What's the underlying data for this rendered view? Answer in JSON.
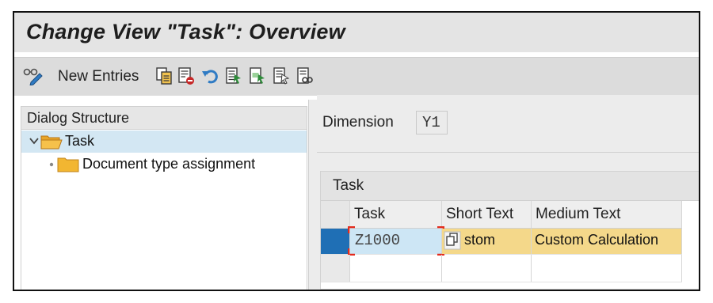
{
  "window": {
    "title": "Change View \"Task\": Overview"
  },
  "toolbar": {
    "new_entries_label": "New Entries",
    "icons": [
      "display-change-icon",
      "copy-as-icon",
      "delete-icon",
      "undo-change-icon",
      "select-all-icon",
      "select-block-icon",
      "deselect-all-icon",
      "print-settings-icon"
    ]
  },
  "dialog_structure": {
    "title": "Dialog Structure",
    "items": [
      {
        "label": "Task",
        "level": 0,
        "selected": true,
        "expanded": true,
        "icon": "folder-open-icon"
      },
      {
        "label": "Document type assignment",
        "level": 1,
        "selected": false,
        "icon": "folder-icon"
      }
    ]
  },
  "dimension": {
    "label": "Dimension",
    "value": "Y1"
  },
  "task_table": {
    "title": "Task",
    "columns": [
      "Task",
      "Short Text",
      "Medium Text"
    ],
    "rows": [
      {
        "task": "Z1000",
        "short_text": "stom",
        "medium_text": "Custom Calculation",
        "selected": true
      }
    ]
  },
  "colors": {
    "selection_blue": "#1f6fb5",
    "row_highlight": "#f4d88a",
    "tree_selected": "#d3e7f3",
    "focus_corner": "#e32b1d"
  }
}
